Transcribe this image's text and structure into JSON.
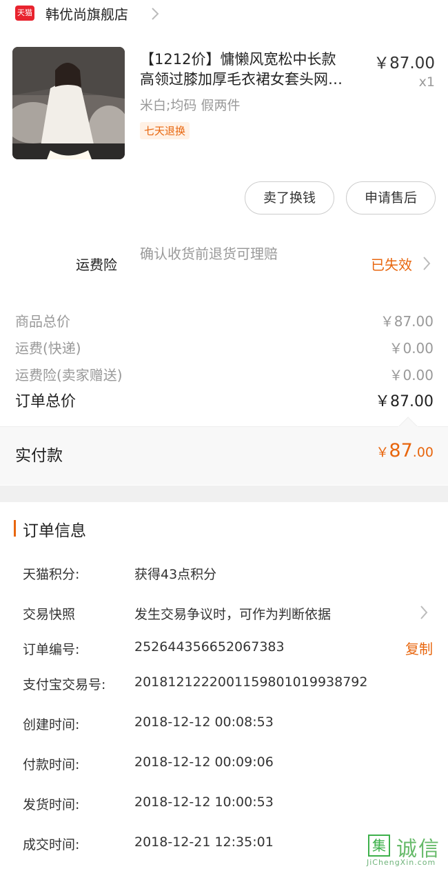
{
  "store": {
    "badge": "天猫",
    "name": "韩优尚旗舰店"
  },
  "product": {
    "title_line1": "【1212价】慵懒风宽松中长款",
    "title_line2": "高领过膝加厚毛衣裙女套头网…",
    "price": "￥87.00",
    "qty": "x1",
    "sku": "米白;均码 假两件",
    "tag": "七天退换"
  },
  "actions": {
    "sell": "卖了换钱",
    "aftersale": "申请售后"
  },
  "insurance": {
    "label": "运费险",
    "desc": "确认收货前退货可理赔",
    "status": "已失效"
  },
  "summary": {
    "rows": [
      {
        "label": "商品总价",
        "value": "￥87.00"
      },
      {
        "label": "运费(快递)",
        "value": "￥0.00"
      },
      {
        "label": "运费险(卖家赠送)",
        "value": "￥0.00"
      }
    ],
    "total_label": "订单总价",
    "total_value": "￥87.00",
    "paid_label": "实付款",
    "paid_currency": "￥",
    "paid_int": "87",
    "paid_dec": ".00"
  },
  "order_info": {
    "title": "订单信息",
    "rows": [
      {
        "label": "天猫积分:",
        "value": "获得43点积分"
      },
      {
        "label": "交易快照",
        "value": "发生交易争议时，可作为判断依据"
      },
      {
        "label": "订单编号:",
        "value": "252644356652067383"
      },
      {
        "label": "支付宝交易号:",
        "value": "2018121222001159801019938792"
      },
      {
        "label": "创建时间:",
        "value": "2018-12-12 00:08:53"
      },
      {
        "label": "付款时间:",
        "value": "2018-12-12 00:09:06"
      },
      {
        "label": "发货时间:",
        "value": "2018-12-12 10:00:53"
      },
      {
        "label": "成交时间:",
        "value": "2018-12-21 12:35:01"
      }
    ],
    "copy_label": "复制"
  },
  "watermark": {
    "box": "集",
    "text": "诚信",
    "sub": "JiChengXin.com"
  },
  "colors": {
    "accent": "#e8660e",
    "tmall_red": "#e8232e"
  }
}
